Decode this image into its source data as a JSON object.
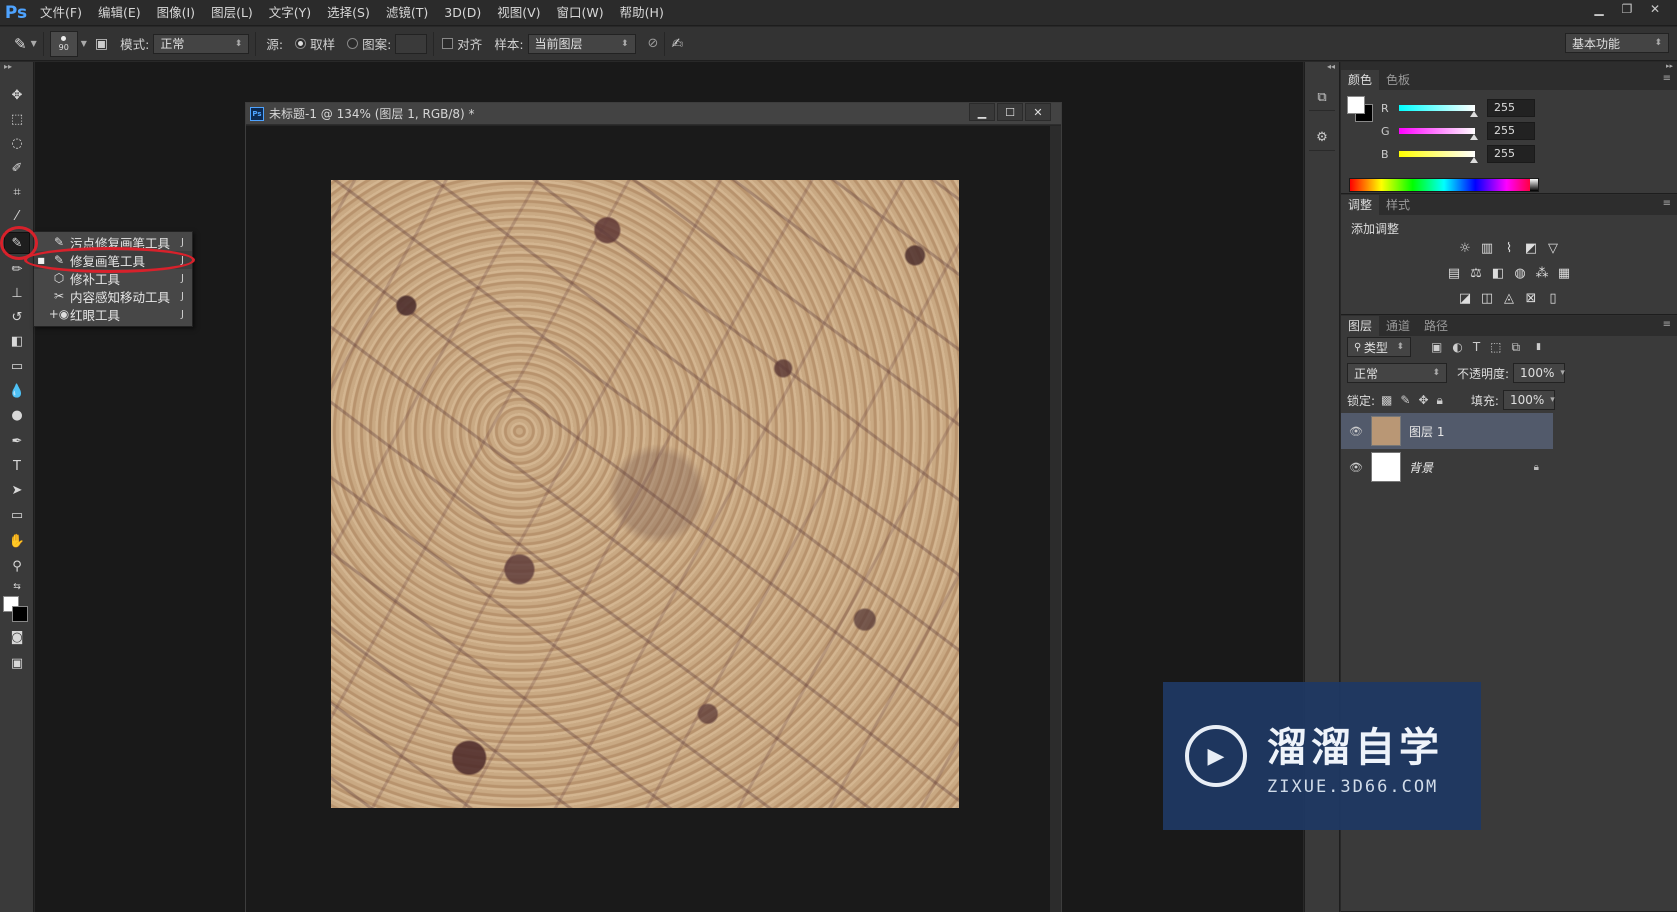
{
  "app": {
    "logo": "Ps"
  },
  "menu": [
    "文件(F)",
    "编辑(E)",
    "图像(I)",
    "图层(L)",
    "文字(Y)",
    "选择(S)",
    "滤镜(T)",
    "3D(D)",
    "视图(V)",
    "窗口(W)",
    "帮助(H)"
  ],
  "options": {
    "brush_size": "90",
    "mode_label": "模式:",
    "mode_value": "正常",
    "source_label": "源:",
    "sampled_label": "取样",
    "pattern_label": "图案:",
    "aligned_label": "对齐",
    "sample_label": "样本:",
    "sample_value": "当前图层",
    "workspace": "基本功能"
  },
  "flyout": {
    "items": [
      {
        "label": "污点修复画笔工具",
        "key": "J",
        "icon": "spot-healing-icon"
      },
      {
        "label": "修复画笔工具",
        "key": "J",
        "icon": "healing-brush-icon",
        "selected": true
      },
      {
        "label": "修补工具",
        "key": "J",
        "icon": "patch-icon"
      },
      {
        "label": "内容感知移动工具",
        "key": "J",
        "icon": "content-aware-move-icon"
      },
      {
        "label": "红眼工具",
        "key": "J",
        "icon": "red-eye-icon"
      }
    ]
  },
  "document": {
    "title": "未标题-1 @ 134% (图层 1, RGB/8) *"
  },
  "color_panel": {
    "tabs": [
      "颜色",
      "色板"
    ],
    "r_label": "R",
    "g_label": "G",
    "b_label": "B",
    "r": "255",
    "g": "255",
    "b": "255"
  },
  "adjust_panel": {
    "tabs": [
      "调整",
      "样式"
    ],
    "heading": "添加调整"
  },
  "layers_panel": {
    "tabs": [
      "图层",
      "通道",
      "路径"
    ],
    "filter": "类型",
    "blend_mode": "正常",
    "opacity_label": "不透明度:",
    "opacity": "100%",
    "lock_label": "锁定:",
    "fill_label": "填充:",
    "fill": "100%",
    "layers": [
      {
        "name": "图层 1",
        "selected": true
      },
      {
        "name": "背景",
        "locked": true
      }
    ]
  },
  "watermark": {
    "cn": "溜溜自学",
    "en": "ZIXUE.3D66.COM"
  },
  "colors": {
    "highlight": "#d8212b",
    "ps_blue": "#4ea3ff",
    "selected_layer": "#525a6b"
  }
}
